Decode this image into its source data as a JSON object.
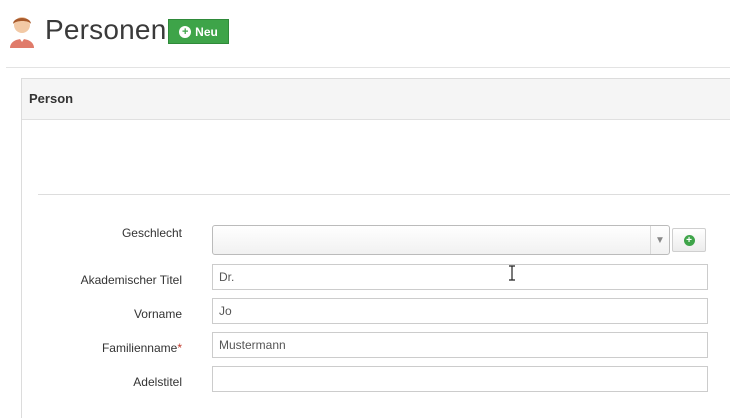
{
  "header": {
    "title": "Personen",
    "new_button_label": "Neu"
  },
  "panel": {
    "title": "Person"
  },
  "form": {
    "fields": [
      {
        "label": "Geschlecht",
        "type": "select",
        "value": ""
      },
      {
        "label": "Akademischer Titel",
        "type": "text",
        "value": "Dr."
      },
      {
        "label": "Vorname",
        "type": "text",
        "value": "Jo"
      },
      {
        "label": "Familienname",
        "required_marker": "*",
        "type": "text",
        "value": "Mustermann"
      },
      {
        "label": "Adelstitel",
        "type": "text",
        "value": ""
      }
    ]
  },
  "icons": {
    "avatar": "person-avatar-icon",
    "new": "plus-circle-icon",
    "add": "plus-circle-icon",
    "dropdown": "chevron-down-icon"
  },
  "colors": {
    "accent_green": "#3ea449",
    "required_red": "#c0392b"
  }
}
